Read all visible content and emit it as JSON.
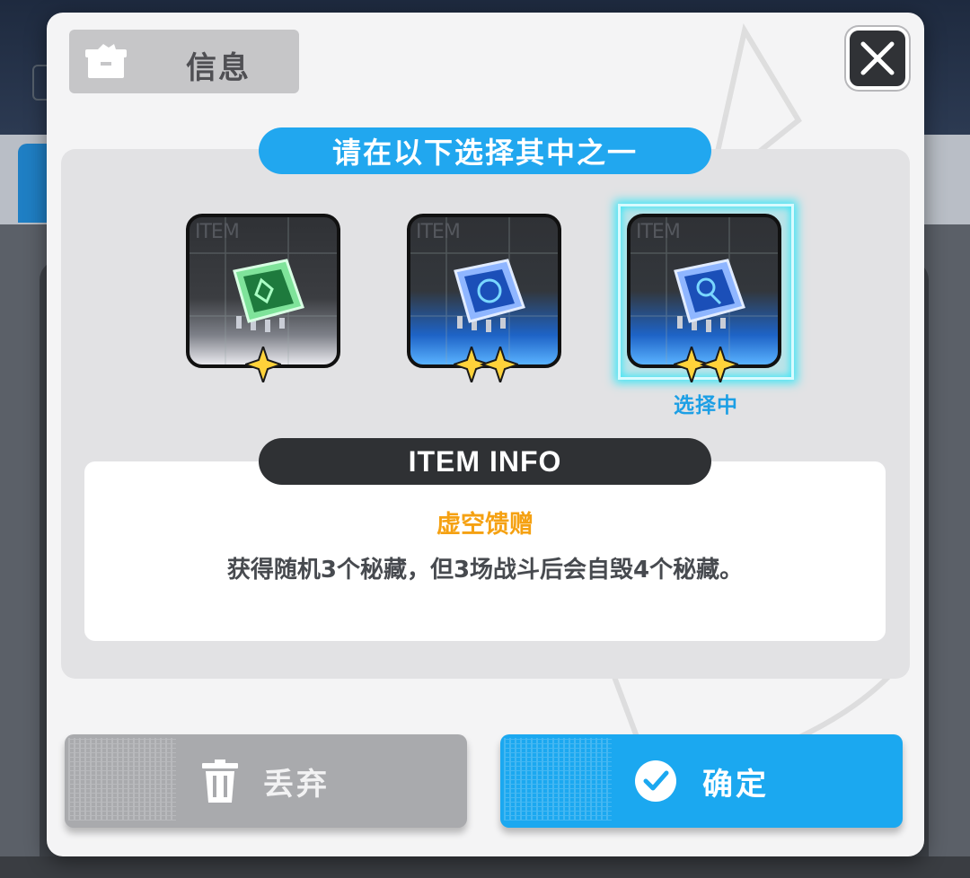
{
  "dialog": {
    "header_label": "信息",
    "close_icon": "close-icon",
    "banner": "请在以下选择其中之一",
    "selected_label": "选择中"
  },
  "items": [
    {
      "watermark": "ITEM",
      "rarity_stars": 1,
      "frame": "white",
      "chip_color": "#3ad36a"
    },
    {
      "watermark": "ITEM",
      "rarity_stars": 2,
      "frame": "blue",
      "chip_color": "#3a8cff"
    },
    {
      "watermark": "ITEM",
      "rarity_stars": 2,
      "frame": "blue",
      "chip_color": "#3a8cff",
      "selected": true
    }
  ],
  "info": {
    "header": "ITEM INFO",
    "title": "虚空馈赠",
    "description": "获得随机3个秘藏，但3场战斗后会自毁4个秘藏。"
  },
  "buttons": {
    "discard": "丢弃",
    "confirm": "确定"
  },
  "colors": {
    "accent_blue": "#1ba8f0",
    "title_orange": "#f5a112",
    "selected_cyan": "#48e6f5",
    "star_gold": "#ffd23a"
  }
}
